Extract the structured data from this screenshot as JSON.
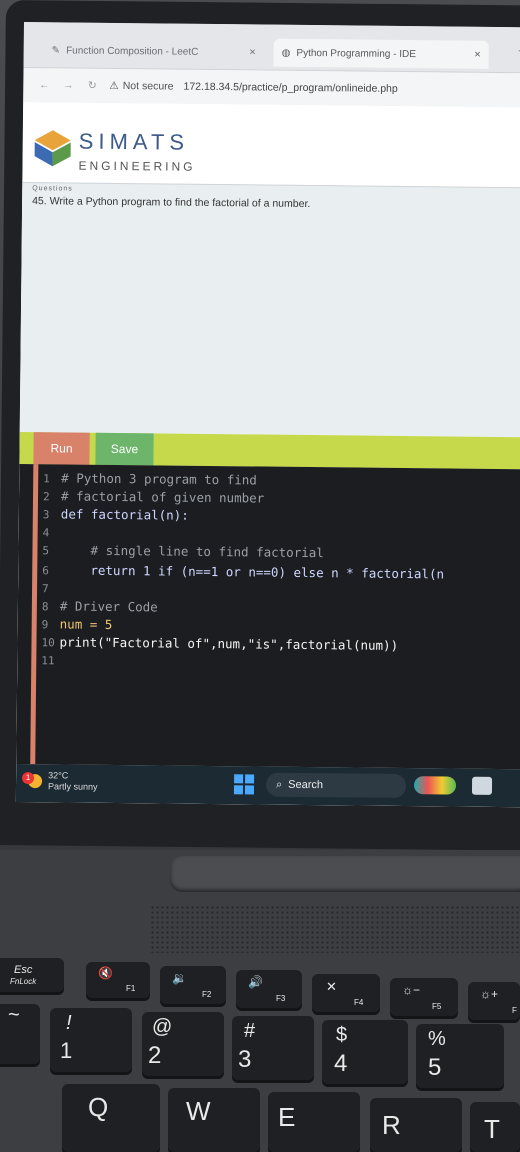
{
  "browser": {
    "tabs": [
      {
        "label": "Function Composition - LeetC",
        "close": "×"
      },
      {
        "label": "Python Programming - IDE",
        "close": "×"
      }
    ],
    "new_tab": "+",
    "security_label": "Not secure",
    "url": "172.18.34.5/practice/p_program/onlineide.php"
  },
  "site": {
    "brand_name": "SIMATS",
    "brand_sub": "ENGINEERING",
    "section_label_partial": "Questions",
    "question": "45. Write a Python program to find the factorial of a number."
  },
  "toolbar": {
    "run_label": "Run",
    "save_label": "Save"
  },
  "editor": {
    "lines": [
      {
        "n": "1",
        "text": "# Python 3 program to find"
      },
      {
        "n": "2",
        "text": "# factorial of given number"
      },
      {
        "n": "3",
        "text": "def factorial(n):"
      },
      {
        "n": "4",
        "text": ""
      },
      {
        "n": "5",
        "text": "    # single line to find factorial"
      },
      {
        "n": "6",
        "text": "    return 1 if (n==1 or n==0) else n * factorial(n"
      },
      {
        "n": "7",
        "text": ""
      },
      {
        "n": "8",
        "text": "# Driver Code"
      },
      {
        "n": "9",
        "text": "num = 5"
      },
      {
        "n": "10",
        "text": "print(\"Factorial of\",num,\"is\",factorial(num))"
      },
      {
        "n": "11",
        "text": ""
      }
    ]
  },
  "taskbar": {
    "weather_temp": "32°C",
    "weather_desc": "Partly sunny",
    "weather_badge": "1",
    "search_label": "Search"
  },
  "keyboard": {
    "fn_row": [
      {
        "top": "Esc",
        "sub": "FnLock"
      },
      {
        "top": "🔇",
        "sub": "F1"
      },
      {
        "top": "🔉",
        "sub": "F2"
      },
      {
        "top": "🔊",
        "sub": "F3"
      },
      {
        "top": "✕",
        "sub": "F4"
      },
      {
        "top": "☼−",
        "sub": "F5"
      },
      {
        "top": "☼+",
        "sub": "F"
      }
    ],
    "number_row": [
      {
        "top": "~",
        "main": ""
      },
      {
        "top": "!",
        "main": "1"
      },
      {
        "top": "@",
        "main": "2"
      },
      {
        "top": "#",
        "main": "3"
      },
      {
        "top": "$",
        "main": "4"
      },
      {
        "top": "%",
        "main": "5"
      }
    ],
    "letter_row": [
      "Q",
      "W",
      "E",
      "R",
      "T"
    ]
  }
}
